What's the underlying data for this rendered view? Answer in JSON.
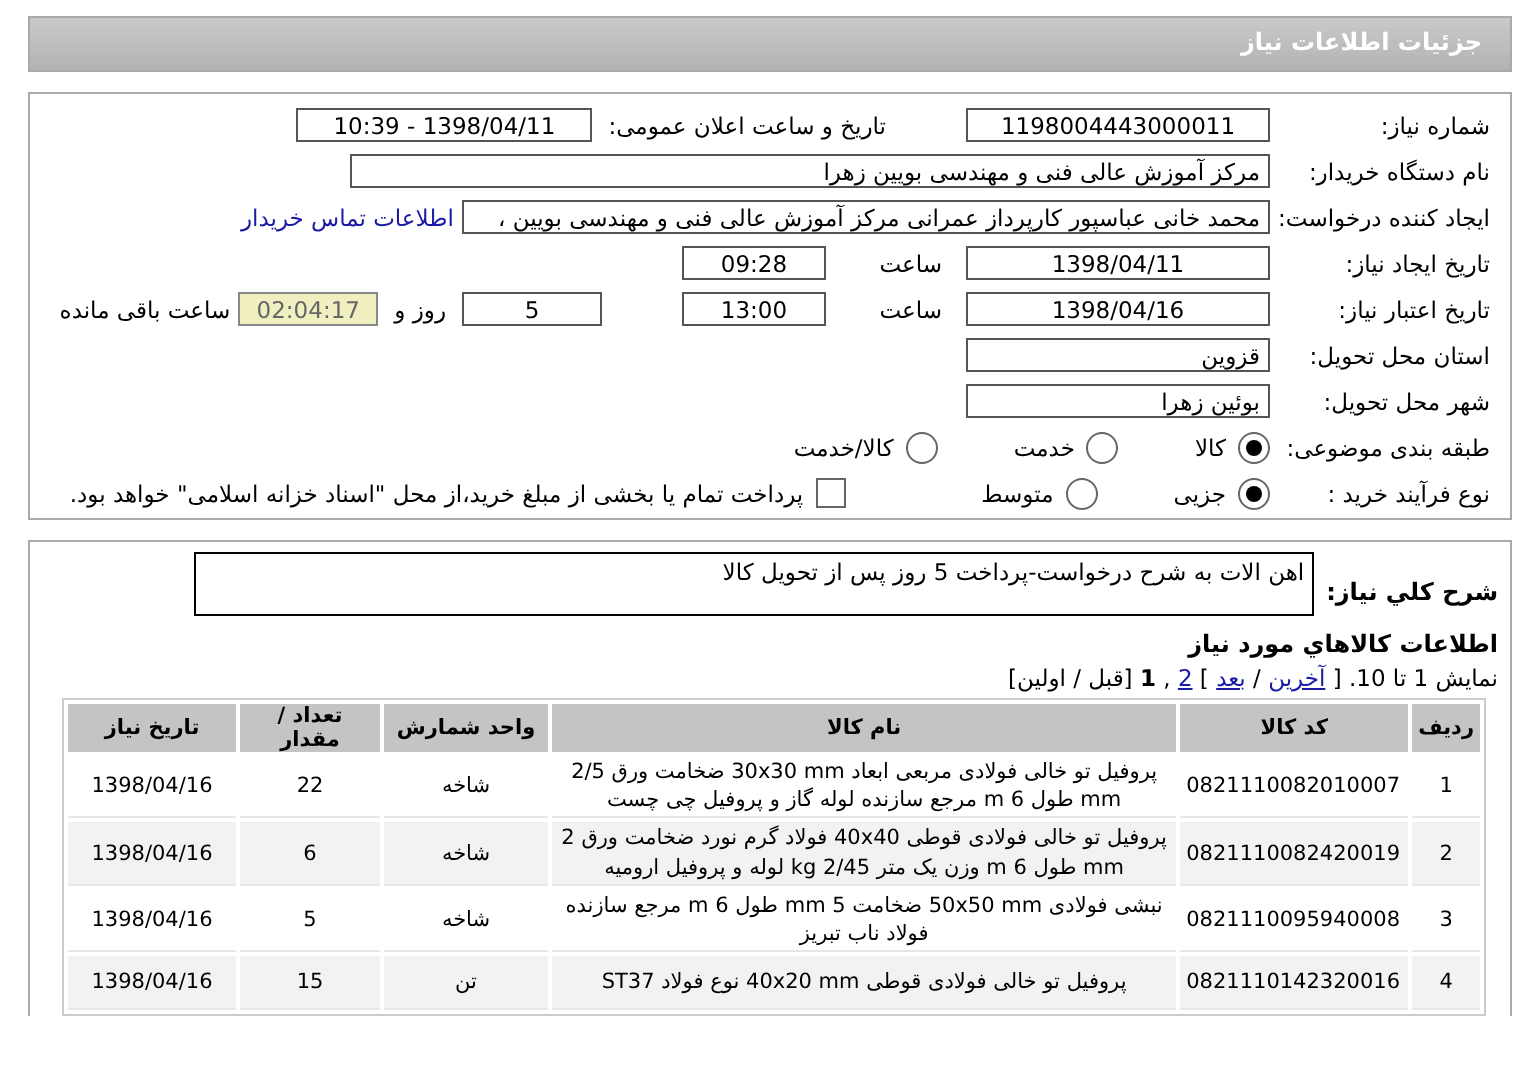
{
  "header": {
    "title": "جزئیات اطلاعات نیاز"
  },
  "details": {
    "need_number": {
      "label": "شماره نیاز:",
      "value": "1198004443000011"
    },
    "announce": {
      "label": "تاریخ و ساعت اعلان عمومی:",
      "value": "1398/04/11 - 10:39"
    },
    "buyer": {
      "label": "نام دستگاه خریدار:",
      "value": "مرکز آموزش عالی فنی و مهندسی بویین زهرا"
    },
    "requester": {
      "label": "ایجاد کننده درخواست:",
      "value": "محمد خانی عباسپور کارپرداز عمرانی مرکز آموزش عالی فنی و مهندسی بویین ،",
      "link": "اطلاعات تماس خریدار"
    },
    "created": {
      "label": "تاریخ ایجاد نیاز:",
      "date": "1398/04/11",
      "time_label": "ساعت",
      "time": "09:28"
    },
    "validity": {
      "label": "تاریخ اعتبار نیاز:",
      "date": "1398/04/16",
      "time_label": "ساعت",
      "time": "13:00",
      "days": "5",
      "days_label": "روز و",
      "remaining": "02:04:17",
      "remaining_label": "ساعت باقی مانده"
    },
    "province": {
      "label": "استان محل تحویل:",
      "value": "قزوین"
    },
    "city": {
      "label": "شهر محل تحویل:",
      "value": "بوئین زهرا"
    },
    "category": {
      "label": "طبقه بندی موضوعی:",
      "options": [
        {
          "label": "کالا",
          "selected": true
        },
        {
          "label": "خدمت",
          "selected": false
        },
        {
          "label": "کالا/خدمت",
          "selected": false
        }
      ]
    },
    "process": {
      "label": "نوع فرآیند خرید :",
      "options": [
        {
          "label": "جزیی",
          "selected": true
        },
        {
          "label": "متوسط",
          "selected": false
        }
      ],
      "treasury": {
        "label": "پرداخت تمام یا بخشی از مبلغ خرید،از محل \"اسناد خزانه اسلامی\" خواهد بود.",
        "checked": false
      }
    }
  },
  "description": {
    "label": "شرح کلي نياز:",
    "text": "اهن الات به شرح درخواست-پرداخت 5 روز پس از تحویل کالا"
  },
  "items": {
    "title": "اطلاعات کالاهاي مورد نياز",
    "pagination": [
      {
        "kind": "text",
        "text": "نمایش 1 تا 10. ["
      },
      {
        "kind": "link",
        "text": "آخرین"
      },
      {
        "kind": "text",
        "text": "/"
      },
      {
        "kind": "link",
        "text": "بعد"
      },
      {
        "kind": "text",
        "text": "]"
      },
      {
        "kind": "link",
        "text": "2"
      },
      {
        "kind": "text",
        "text": ","
      },
      {
        "kind": "current",
        "text": "1"
      },
      {
        "kind": "text",
        "text": "[قبل / اولین]"
      }
    ],
    "columns": [
      "ردیف",
      "کد کالا",
      "نام کالا",
      "واحد شمارش",
      "تعداد / مقدار",
      "تاریخ نیاز"
    ],
    "rows": [
      [
        "1",
        "0821110082010007",
        "پروفیل تو خالی فولادی مربعی ابعاد 30x30 mm ضخامت ورق 2/5 mm طول 6 m مرجع سازنده لوله گاز و پروفیل چی چست",
        "شاخه",
        "22",
        "1398/04/16"
      ],
      [
        "2",
        "0821110082420019",
        "پروفیل تو خالی فولادی قوطی 40x40 فولاد گرم نورد ضخامت ورق 2 mm طول 6 m وزن یک متر 2/45 kg لوله و پروفیل ارومیه",
        "شاخه",
        "6",
        "1398/04/16"
      ],
      [
        "3",
        "0821110095940008",
        "نبشی فولادی 50x50 mm ضخامت 5 mm طول 6 m مرجع سازنده فولاد ناب تبریز",
        "شاخه",
        "5",
        "1398/04/16"
      ],
      [
        "4",
        "0821110142320016",
        "پروفیل تو خالی فولادی قوطی 40x20 mm نوع فولاد ST37",
        "تن",
        "15",
        "1398/04/16"
      ]
    ]
  }
}
